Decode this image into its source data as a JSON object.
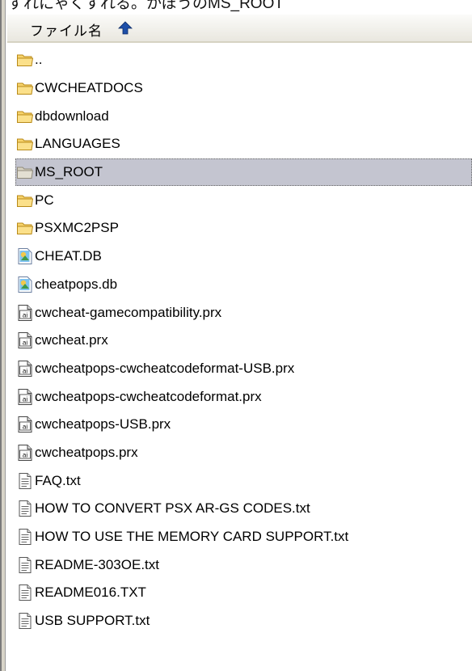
{
  "top_partial_text": "ずれにゃくすれる。かぼうのMS_ROOT",
  "header": {
    "column_label": "ファイル名",
    "sort_icon": "sort-ascending-arrow-icon"
  },
  "files": [
    {
      "name": "..",
      "type": "folder"
    },
    {
      "name": "CWCHEATDOCS",
      "type": "folder"
    },
    {
      "name": "dbdownload",
      "type": "folder"
    },
    {
      "name": "LANGUAGES",
      "type": "folder"
    },
    {
      "name": "MS_ROOT",
      "type": "folder",
      "selected": true
    },
    {
      "name": "PC",
      "type": "folder"
    },
    {
      "name": "PSXMC2PSP",
      "type": "folder"
    },
    {
      "name": "CHEAT.DB",
      "type": "db"
    },
    {
      "name": "cheatpops.db",
      "type": "db"
    },
    {
      "name": "cwcheat-gamecompatibility.prx",
      "type": "prx"
    },
    {
      "name": "cwcheat.prx",
      "type": "prx"
    },
    {
      "name": "cwcheatpops-cwcheatcodeformat-USB.prx",
      "type": "prx"
    },
    {
      "name": "cwcheatpops-cwcheatcodeformat.prx",
      "type": "prx"
    },
    {
      "name": "cwcheatpops-USB.prx",
      "type": "prx"
    },
    {
      "name": "cwcheatpops.prx",
      "type": "prx"
    },
    {
      "name": "FAQ.txt",
      "type": "txt"
    },
    {
      "name": "HOW TO CONVERT PSX AR-GS CODES.txt",
      "type": "txt"
    },
    {
      "name": "HOW TO USE THE MEMORY CARD SUPPORT.txt",
      "type": "txt"
    },
    {
      "name": "README-303OE.txt",
      "type": "txt"
    },
    {
      "name": "README016.TXT",
      "type": "txt"
    },
    {
      "name": "USB SUPPORT.txt",
      "type": "txt"
    }
  ]
}
